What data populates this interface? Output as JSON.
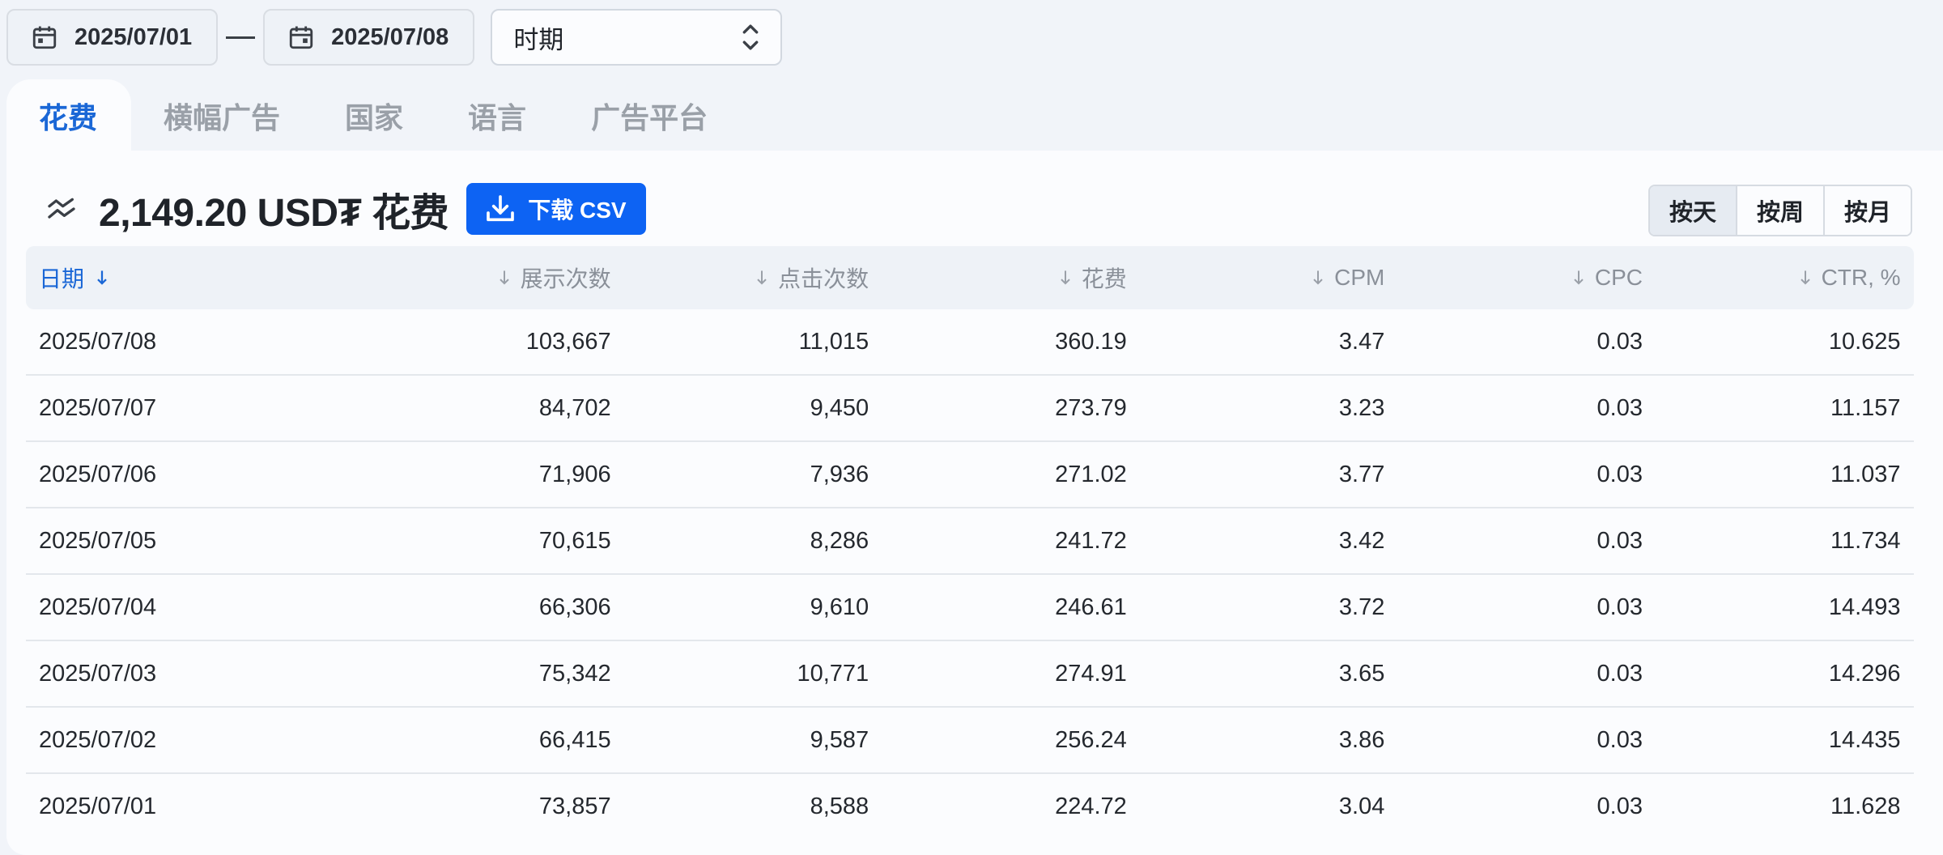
{
  "filters": {
    "start_date": "2025/07/01",
    "end_date": "2025/07/08",
    "period_select": "时期"
  },
  "tabs": [
    {
      "label": "花费",
      "active": true
    },
    {
      "label": "横幅广告",
      "active": false
    },
    {
      "label": "国家",
      "active": false
    },
    {
      "label": "语言",
      "active": false
    },
    {
      "label": "广告平台",
      "active": false
    }
  ],
  "summary": {
    "total_label": "2,149.20 USD₮ 花费",
    "download_label": "下载 CSV"
  },
  "period_toggle": [
    {
      "label": "按天",
      "active": true
    },
    {
      "label": "按周",
      "active": false
    },
    {
      "label": "按月",
      "active": false
    }
  ],
  "table": {
    "columns": [
      "日期",
      "展示次数",
      "点击次数",
      "花费",
      "CPM",
      "CPC",
      "CTR, %"
    ],
    "rows": [
      [
        "2025/07/08",
        "103,667",
        "11,015",
        "360.19",
        "3.47",
        "0.03",
        "10.625"
      ],
      [
        "2025/07/07",
        "84,702",
        "9,450",
        "273.79",
        "3.23",
        "0.03",
        "11.157"
      ],
      [
        "2025/07/06",
        "71,906",
        "7,936",
        "271.02",
        "3.77",
        "0.03",
        "11.037"
      ],
      [
        "2025/07/05",
        "70,615",
        "8,286",
        "241.72",
        "3.42",
        "0.03",
        "11.734"
      ],
      [
        "2025/07/04",
        "66,306",
        "9,610",
        "246.61",
        "3.72",
        "0.03",
        "14.493"
      ],
      [
        "2025/07/03",
        "75,342",
        "10,771",
        "274.91",
        "3.65",
        "0.03",
        "14.296"
      ],
      [
        "2025/07/02",
        "66,415",
        "9,587",
        "256.24",
        "3.86",
        "0.03",
        "14.435"
      ],
      [
        "2025/07/01",
        "73,857",
        "8,588",
        "224.72",
        "3.04",
        "0.03",
        "11.628"
      ]
    ]
  },
  "colors": {
    "accent": "#1a67d6",
    "button": "#0d63f3",
    "background": "#f1f4f9",
    "panel": "#fbfcfe"
  },
  "icons": {
    "date": "calendar-icon",
    "select": "chevron-up-down-icon",
    "summary": "trend-icon",
    "download": "download-icon",
    "sort": "sort-arrow-down-icon"
  }
}
